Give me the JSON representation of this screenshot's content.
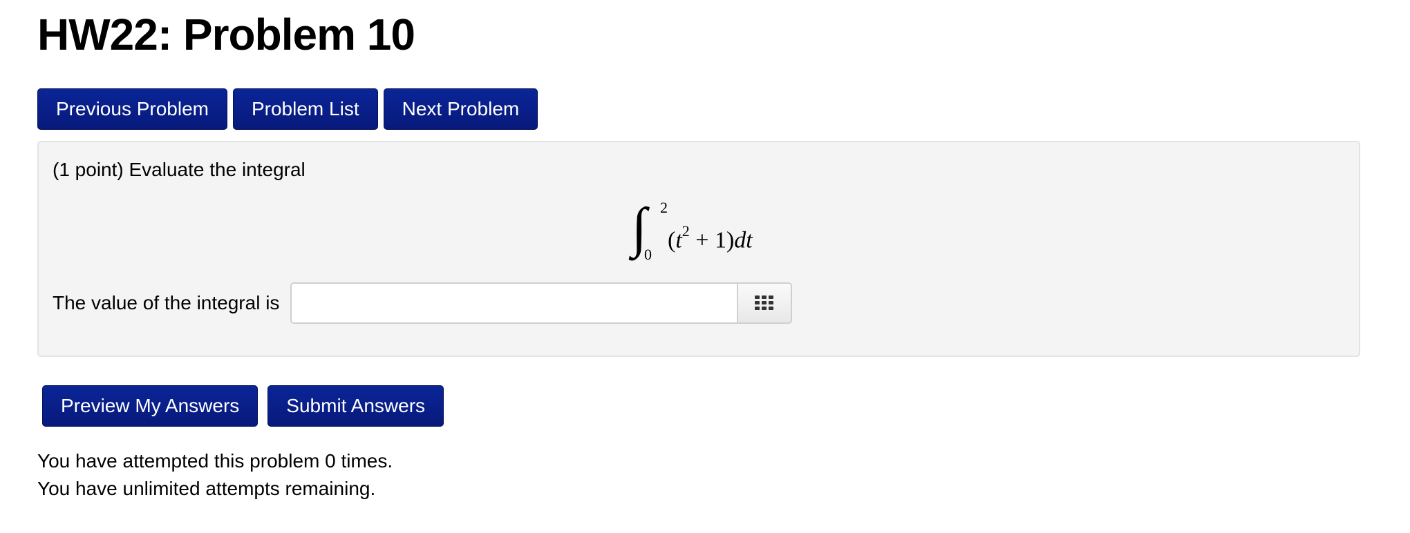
{
  "page": {
    "title": "HW22: Problem 10"
  },
  "nav": {
    "previous_label": "Previous Problem",
    "list_label": "Problem List",
    "next_label": "Next Problem"
  },
  "problem": {
    "intro": "(1 point) Evaluate the integral",
    "integral": {
      "upper_limit": "2",
      "lower_limit": "0",
      "integrand_open": "(",
      "variable": "t",
      "exponent": "2",
      "integrand_rest": " + 1)",
      "differential": "dt"
    },
    "answer_label": "The value of the integral is",
    "answer_value": "",
    "answer_placeholder": "",
    "keypad_icon": "keypad-grid-icon"
  },
  "actions": {
    "preview_label": "Preview My Answers",
    "submit_label": "Submit Answers"
  },
  "status": {
    "attempts_line": "You have attempted this problem 0 times.",
    "remaining_line": "You have unlimited attempts remaining."
  },
  "colors": {
    "button_bg": "#07197b",
    "panel_bg": "#f4f4f4"
  }
}
